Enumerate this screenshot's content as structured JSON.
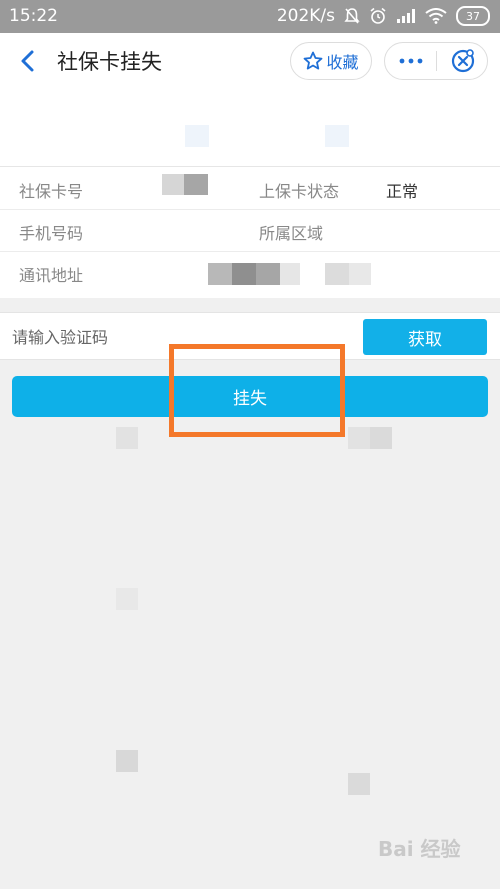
{
  "status_bar": {
    "time": "15:22",
    "network_speed": "202K/s",
    "battery": "37",
    "icons": [
      "mute-bell-icon",
      "alarm-icon",
      "signal-icon",
      "wifi-icon",
      "battery-icon"
    ]
  },
  "nav": {
    "title": "社保卡挂失",
    "favorite_label": "收藏",
    "icons": {
      "back": "chevron-left-icon",
      "favorite": "star-icon",
      "more": "more-dots-icon",
      "close": "close-circle-icon"
    }
  },
  "info": {
    "rows": [
      {
        "label": "社保卡号",
        "label2": "上保卡状态",
        "value2": "正常"
      },
      {
        "label": "手机号码",
        "label2": "所属区域"
      },
      {
        "label": "通讯地址"
      }
    ]
  },
  "verify": {
    "placeholder": "请输入验证码",
    "get_code_label": "获取"
  },
  "actions": {
    "report_loss_label": "挂失"
  },
  "watermark": {
    "text": "Bai 经验"
  },
  "colors": {
    "accent": "#0eb0e8",
    "brand_blue": "#1f6fd6",
    "highlight": "#f4782a",
    "status_bar": "#9a9a9a"
  }
}
